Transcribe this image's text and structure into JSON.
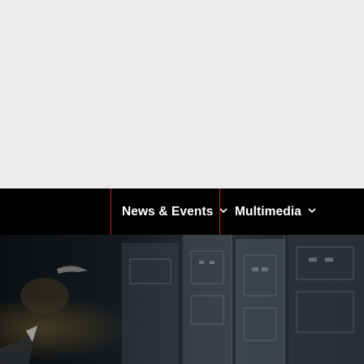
{
  "nav": {
    "items": [
      {
        "label": "News & Events",
        "icon": "chevron-down-icon"
      },
      {
        "label": "Multimedia",
        "icon": "chevron-down-icon"
      }
    ]
  },
  "hero": {
    "description": "dark image of the interior of a spacecraft with control panels and equipment"
  },
  "colors": {
    "nav_background": "#000000",
    "nav_text": "#ffffff",
    "nav_divider": "#d11c2a",
    "page_background": "#ececed"
  }
}
